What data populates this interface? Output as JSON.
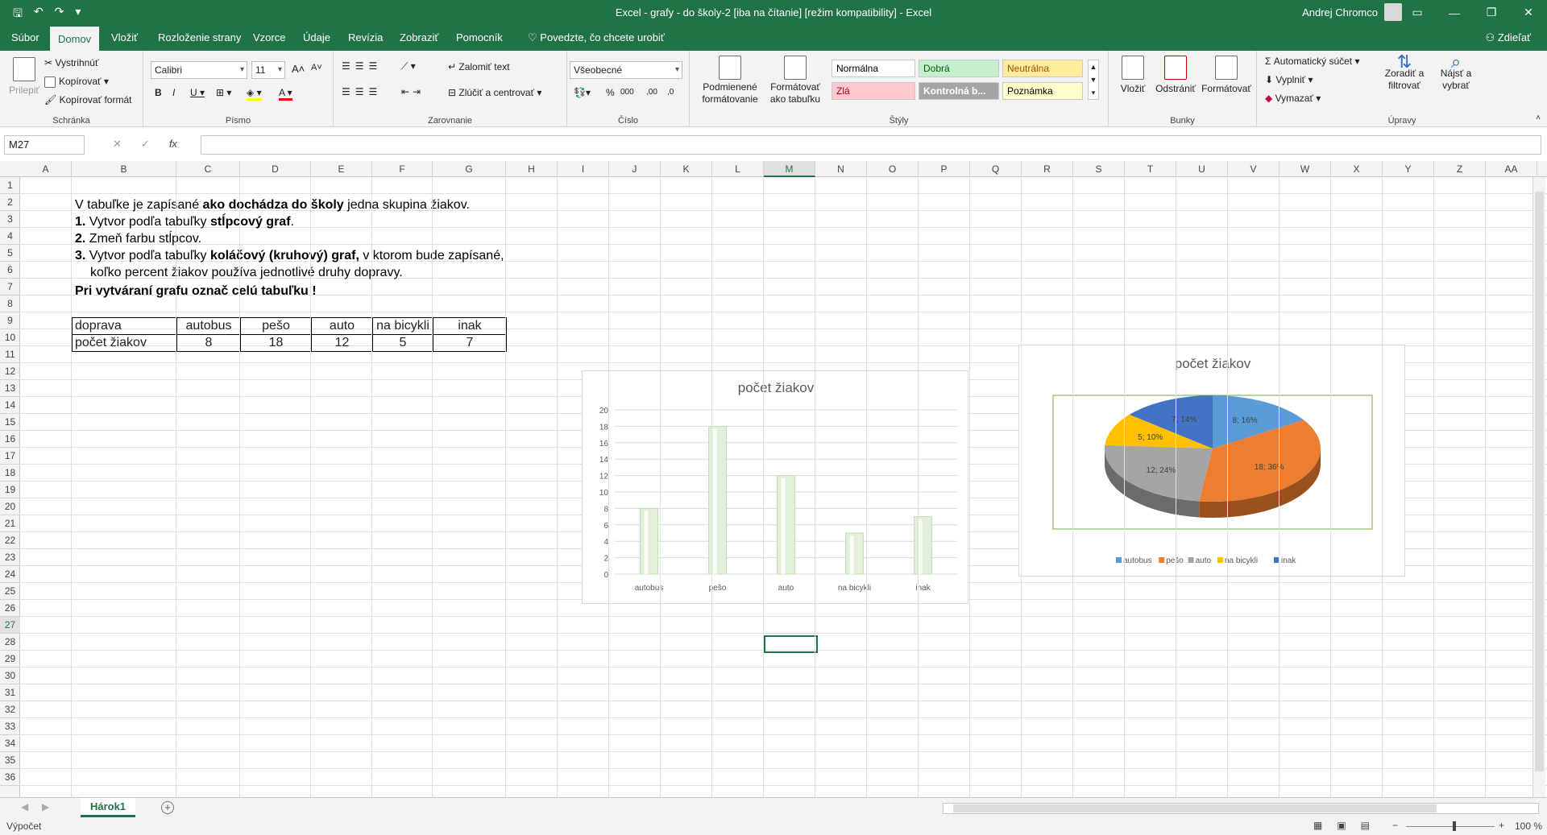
{
  "window": {
    "title": "Excel - grafy - do školy-2  [iba na čítanie]  [režim kompatibility]  -  Excel",
    "user": "Andrej Chromco"
  },
  "tabs": [
    {
      "label": "Súbor"
    },
    {
      "label": "Domov"
    },
    {
      "label": "Vložiť"
    },
    {
      "label": "Rozloženie strany"
    },
    {
      "label": "Vzorce"
    },
    {
      "label": "Údaje"
    },
    {
      "label": "Revízia"
    },
    {
      "label": "Zobraziť"
    },
    {
      "label": "Pomocník"
    }
  ],
  "tell_me": "Povedzte, čo chcete urobiť",
  "share": "Zdieľať",
  "ribbon": {
    "clipboard": {
      "label": "Schránka",
      "paste": "Prilepiť",
      "cut": "Vystrihnúť",
      "copy": "Kopírovať",
      "format_painter": "Kopírovať formát"
    },
    "font": {
      "label": "Písmo",
      "name": "Calibri",
      "size": "11"
    },
    "alignment": {
      "label": "Zarovnanie",
      "wrap": "Zalomiť text",
      "merge": "Zlúčiť a centrovať"
    },
    "number": {
      "label": "Číslo",
      "format": "Všeobecné"
    },
    "styles": {
      "label": "Štýly",
      "cond": "Podmienené formátovanie",
      "table": "Formátovať ako tabuľku",
      "cells": [
        {
          "name": "Normálna",
          "bg": "#ffffff",
          "fg": "#000000"
        },
        {
          "name": "Dobrá",
          "bg": "#c6efce",
          "fg": "#006100"
        },
        {
          "name": "Neutrálna",
          "bg": "#ffeb9c",
          "fg": "#9c5700"
        },
        {
          "name": "Zlá",
          "bg": "#ffc7ce",
          "fg": "#9c0006"
        },
        {
          "name": "Kontrolná b...",
          "bg": "#a5a5a5",
          "fg": "#ffffff"
        },
        {
          "name": "Poznámka",
          "bg": "#ffffcc",
          "fg": "#000000"
        }
      ]
    },
    "cells": {
      "label": "Bunky",
      "insert": "Vložiť",
      "delete": "Odstrániť",
      "format": "Formátovať"
    },
    "editing": {
      "label": "Úpravy",
      "autosum": "Automatický súčet",
      "fill": "Vyplniť",
      "clear": "Vymazať",
      "sort": "Zoradiť a filtrovať",
      "find": "Nájsť a vybrať"
    }
  },
  "name_box": "M27",
  "columns": [
    "A",
    "B",
    "C",
    "D",
    "E",
    "F",
    "G",
    "H",
    "I",
    "J",
    "K",
    "L",
    "M",
    "N",
    "O",
    "P",
    "Q",
    "R",
    "S",
    "T",
    "U",
    "V",
    "W",
    "X",
    "Y",
    "Z",
    "AA"
  ],
  "rows": [
    "1",
    "2",
    "3",
    "4",
    "5",
    "6",
    "7",
    "8",
    "9",
    "10",
    "11",
    "12",
    "13",
    "14",
    "15",
    "16",
    "17",
    "18",
    "19",
    "20",
    "21",
    "22",
    "23",
    "24",
    "25",
    "26",
    "27",
    "28",
    "29",
    "30",
    "31",
    "32",
    "33",
    "34",
    "35",
    "36"
  ],
  "sheet_text": {
    "l2a": "V tabuľke je zapísané ",
    "l2b": "ako dochádza do školy",
    "l2c": " jedna skupina žiakov.",
    "l3a": "1.",
    "l3b": " Vytvor podľa tabuľky ",
    "l3c": "stĺpcový graf",
    "l4a": "2.",
    "l4b": " Zmeň farbu stĺpcov.",
    "l5a": "3.",
    "l5b": " Vytvor podľa tabuľky ",
    "l5c": "koláčový (kruhový) graf,",
    "l5d": " v ktorom bude zapísané,",
    "l5e": "koľko percent žiakov používa jednotlivé druhy dopravy.",
    "l6": "Pri vytváraní grafu označ celú tabuľku !"
  },
  "table": {
    "header": [
      "doprava",
      "autobus",
      "pešo",
      "auto",
      "na bicykli",
      "inak"
    ],
    "row": [
      "počet žiakov",
      "8",
      "18",
      "12",
      "5",
      "7"
    ]
  },
  "chart_data": [
    {
      "type": "bar",
      "title": "počet žiakov",
      "categories": [
        "autobus",
        "pešo",
        "auto",
        "na bicykli",
        "inak"
      ],
      "values": [
        8,
        18,
        12,
        5,
        7
      ],
      "ylim": [
        0,
        20
      ],
      "yticks": [
        0,
        2,
        4,
        6,
        8,
        10,
        12,
        14,
        16,
        18,
        20
      ],
      "grid": true,
      "bar_color": "#e2f0d9"
    },
    {
      "type": "pie",
      "title": "počet žiakov",
      "categories": [
        "autobus",
        "pešo",
        "auto",
        "na bicykli",
        "inak"
      ],
      "values": [
        8,
        18,
        12,
        5,
        7
      ],
      "labels": [
        "8; 16%",
        "18; 36%",
        "12; 24%",
        "5; 10%",
        "7; 14%"
      ],
      "colors": [
        "#5b9bd5",
        "#ed7d31",
        "#a5a5a5",
        "#ffc000",
        "#4472c4"
      ],
      "legend": "bottom"
    }
  ],
  "sheet_tab": "Hárok1",
  "status": {
    "mode": "Výpočet",
    "zoom": "100 %"
  }
}
